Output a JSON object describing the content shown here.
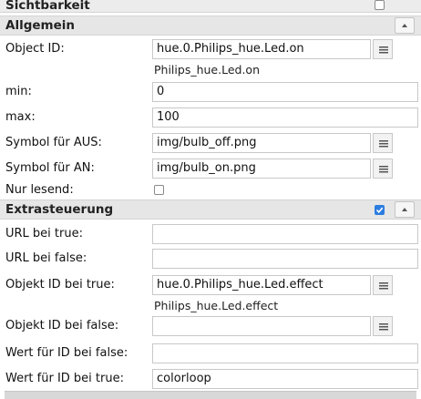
{
  "sichtbarkeit": {
    "title": "Sichtbarkeit",
    "checked": false
  },
  "allgemein": {
    "title": "Allgemein",
    "object_id_label": "Object ID:",
    "object_id_value": "hue.0.Philips_hue.Led.on",
    "object_id_hint": "Philips_hue.Led.on",
    "min_label": "min:",
    "min_value": "0",
    "max_label": "max:",
    "max_value": "100",
    "symbol_aus_label": "Symbol für AUS:",
    "symbol_aus_value": "img/bulb_off.png",
    "symbol_an_label": "Symbol für AN:",
    "symbol_an_value": "img/bulb_on.png",
    "readonly_label": "Nur lesend:",
    "readonly_checked": false
  },
  "extrasteuerung": {
    "title": "Extrasteuerung",
    "enabled": true,
    "url_true_label": "URL bei true:",
    "url_true_value": "",
    "url_false_label": "URL bei false:",
    "url_false_value": "",
    "obj_true_label": "Objekt ID bei true:",
    "obj_true_value": "hue.0.Philips_hue.Led.effect",
    "obj_true_hint": "Philips_hue.Led.effect",
    "obj_false_label": "Objekt ID bei false:",
    "obj_false_value": "",
    "wert_false_label": "Wert für ID bei false:",
    "wert_false_value": "",
    "wert_true_label": "Wert für ID bei true:",
    "wert_true_value": "colorloop"
  },
  "icons": {
    "picker": "list-picker-icon",
    "collapse": "chevron-up-icon"
  },
  "colors": {
    "header_bg": "#e6e6e6",
    "checkbox_accent": "#2d7de0"
  }
}
